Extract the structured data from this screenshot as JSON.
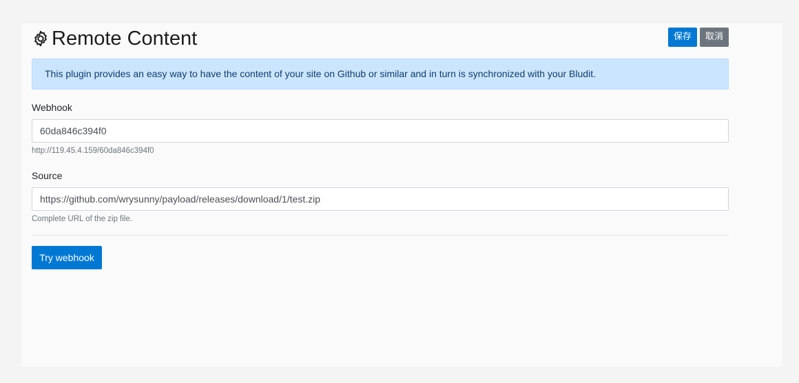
{
  "header": {
    "title": "Remote Content",
    "title_icon": "gear-icon",
    "save_label": "保存",
    "cancel_label": "取消"
  },
  "alert": {
    "text": "This plugin provides an easy way to have the content of your site on Github or similar and in turn is synchronized with your Bludit."
  },
  "form": {
    "webhook": {
      "label": "Webhook",
      "value": "60da846c394f0",
      "help": "http://119.45.4.159/60da846c394f0"
    },
    "source": {
      "label": "Source",
      "value": "https://github.com/wrysunny/payload/releases/download/1/test.zip",
      "help": "Complete URL of the zip file."
    },
    "try_button_label": "Try webhook"
  },
  "colors": {
    "primary": "#0078d4",
    "secondary": "#6c757d",
    "alert_bg": "#cce5ff"
  }
}
